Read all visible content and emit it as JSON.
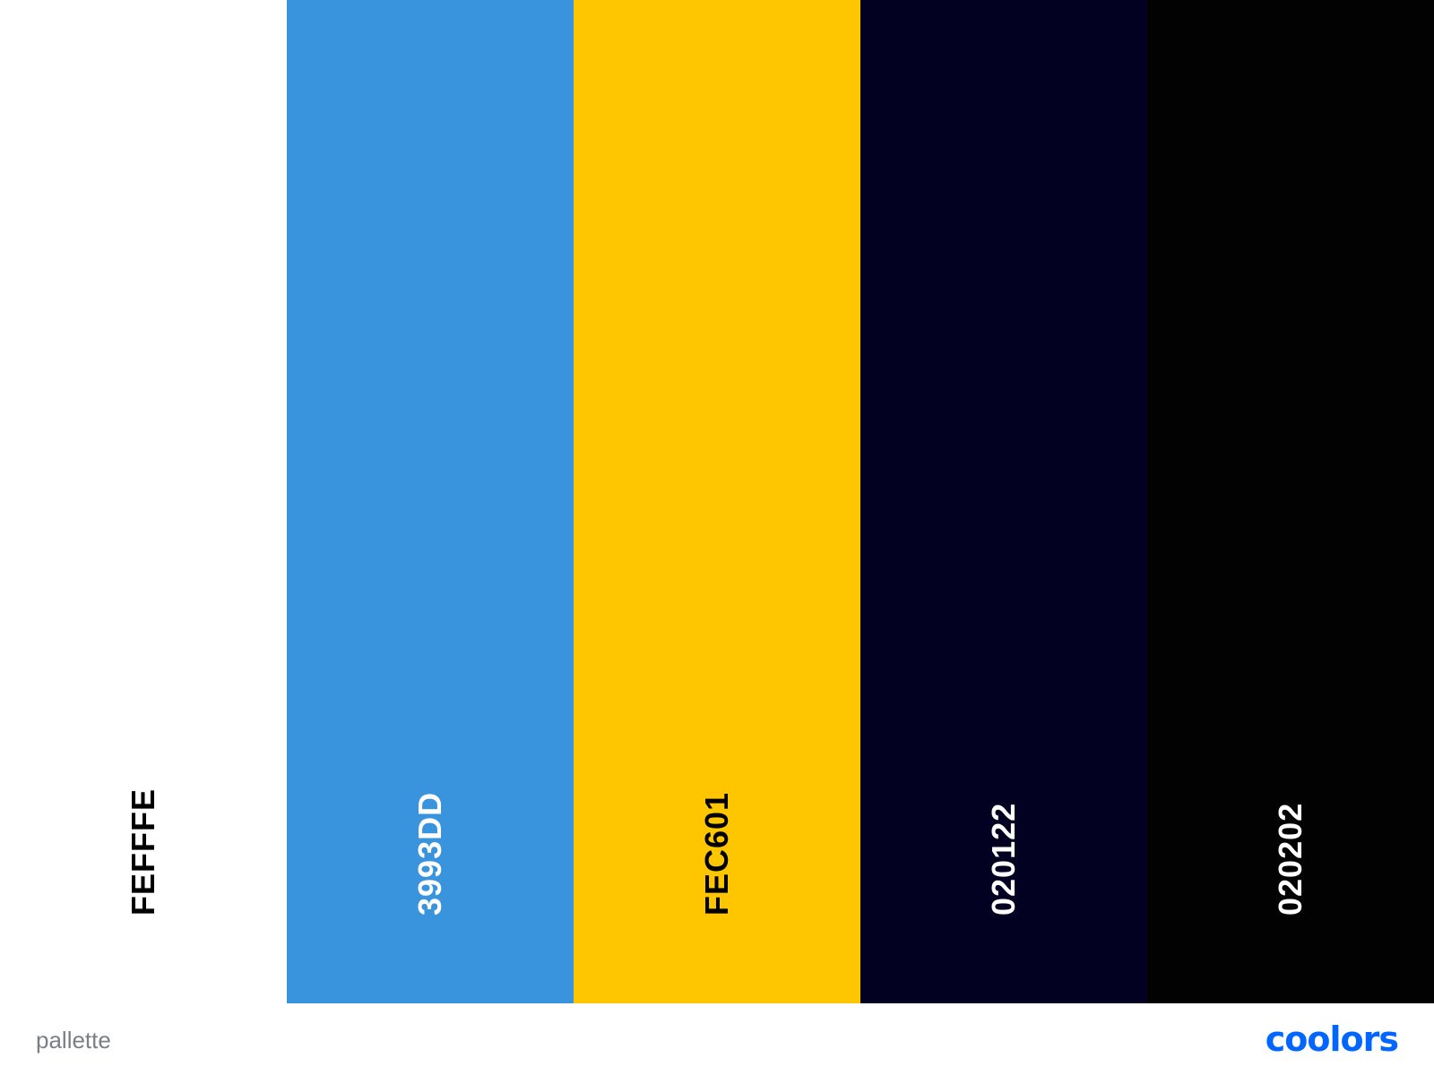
{
  "palette": {
    "swatches": [
      {
        "hex": "FEFFFE",
        "color": "#FEFFFE",
        "text_color": "#000000"
      },
      {
        "hex": "3993DD",
        "color": "#3993DD",
        "text_color": "#FFFFFF"
      },
      {
        "hex": "FEC601",
        "color": "#FEC601",
        "text_color": "#000000"
      },
      {
        "hex": "020122",
        "color": "#020122",
        "text_color": "#FFFFFF"
      },
      {
        "hex": "020202",
        "color": "#020202",
        "text_color": "#FFFFFF"
      }
    ]
  },
  "footer": {
    "name": "pallette",
    "logo_text": "coolors",
    "logo_color": "#0066FF"
  }
}
